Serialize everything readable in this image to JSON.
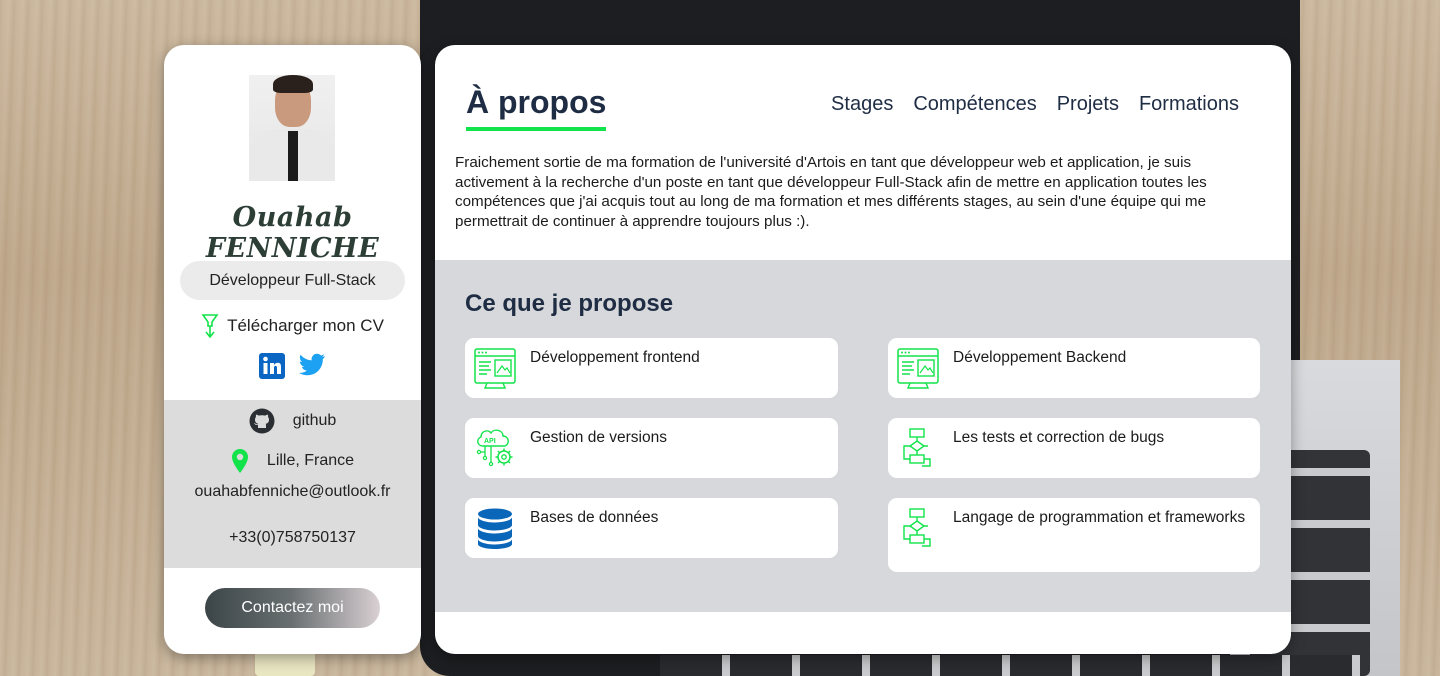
{
  "profile": {
    "name": "Ouahab FENNICHE",
    "role": "Développeur Full-Stack",
    "cv_label": "Télécharger mon CV",
    "github_label": "github",
    "location": "Lille, France",
    "email": "ouahabfenniche@outlook.fr",
    "phone": "+33(0)758750137",
    "contact_button": "Contactez moi"
  },
  "main": {
    "title": "À propos",
    "nav": [
      "Stages",
      "Compétences",
      "Projets",
      "Formations"
    ],
    "about": "Fraichement sortie de ma formation de l'université d'Artois en tant que développeur web et application, je suis activement à la recherche d'un poste en tant que développeur Full-Stack afin de mettre en application toutes les compétences que j'ai acquis tout au long de ma formation et mes différents stages, au sein d'une équipe qui me permettrait de continuer à apprendre toujours plus :).",
    "services_title": "Ce que je propose",
    "services": [
      {
        "label": "Développement frontend",
        "icon": "web-dev-icon"
      },
      {
        "label": "Développement Backend",
        "icon": "web-dev-icon"
      },
      {
        "label": "Gestion de versions",
        "icon": "api-gear-icon"
      },
      {
        "label": "Les tests et correction de bugs",
        "icon": "flowchart-icon"
      },
      {
        "label": "Bases de données",
        "icon": "database-icon"
      },
      {
        "label": "Langage de programmation et frameworks",
        "icon": "flowchart-icon"
      }
    ]
  },
  "colors": {
    "accent_green": "#12e34a",
    "heading_navy": "#1f2d44",
    "linkedin_blue": "#0a66c2",
    "twitter_blue": "#1da1f2"
  }
}
